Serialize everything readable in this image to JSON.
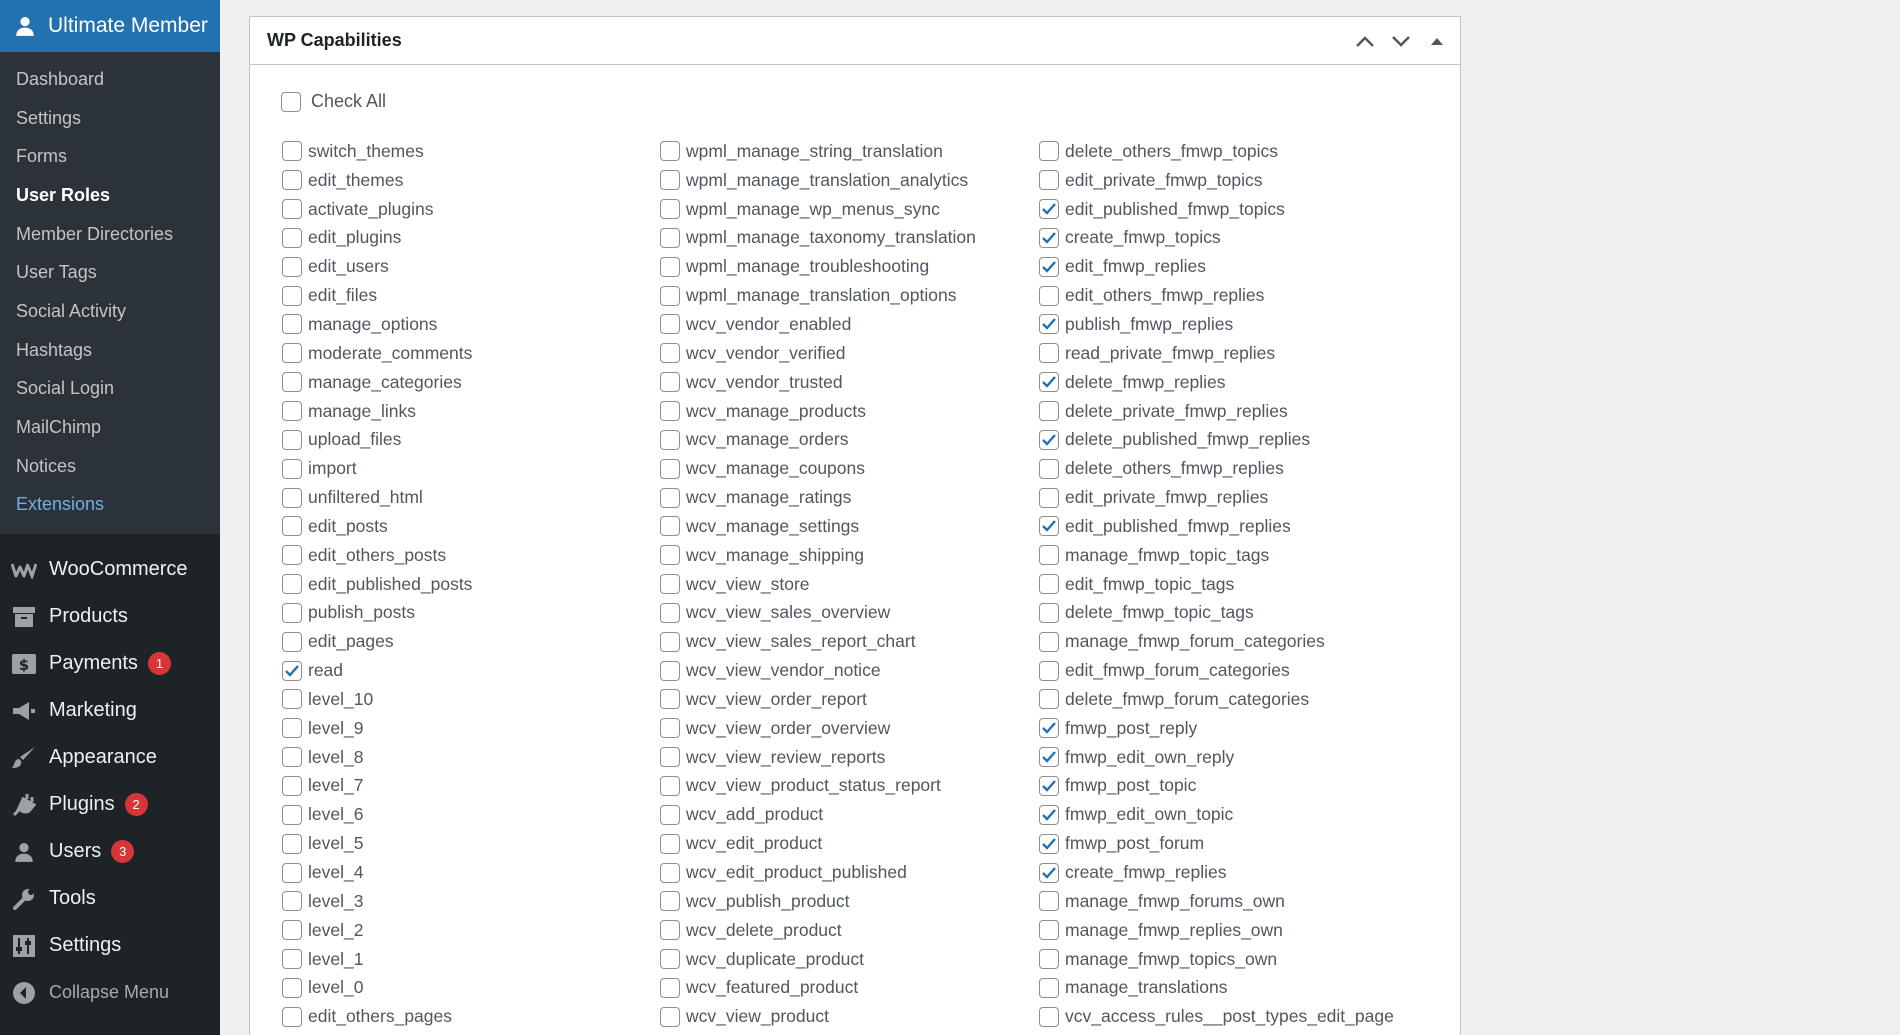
{
  "sidebar": {
    "header_label": "Ultimate Member",
    "header_icon": "user-icon",
    "submenu": [
      {
        "label": "Dashboard"
      },
      {
        "label": "Settings"
      },
      {
        "label": "Forms"
      },
      {
        "label": "User Roles",
        "current": true
      },
      {
        "label": "Member Directories"
      },
      {
        "label": "User Tags"
      },
      {
        "label": "Social Activity"
      },
      {
        "label": "Hashtags"
      },
      {
        "label": "Social Login"
      },
      {
        "label": "MailChimp"
      },
      {
        "label": "Notices"
      },
      {
        "label": "Extensions"
      }
    ],
    "menu": [
      {
        "label": "WooCommerce",
        "icon": "woocommerce-icon"
      },
      {
        "label": "Products",
        "icon": "archive-box-icon"
      },
      {
        "label": "Payments",
        "icon": "dollar-icon",
        "badge": "1"
      },
      {
        "label": "Marketing",
        "icon": "megaphone-icon"
      },
      {
        "label": "Appearance",
        "icon": "paintbrush-icon"
      },
      {
        "label": "Plugins",
        "icon": "plug-icon",
        "badge": "2"
      },
      {
        "label": "Users",
        "icon": "user-icon",
        "badge": "3"
      },
      {
        "label": "Tools",
        "icon": "wrench-icon"
      },
      {
        "label": "Settings",
        "icon": "settings-sliders-icon"
      }
    ],
    "collapse_label": "Collapse Menu"
  },
  "panel": {
    "title": "WP Capabilities",
    "check_all_label": "Check All",
    "columns": [
      [
        {
          "name": "switch_themes",
          "checked": false
        },
        {
          "name": "edit_themes",
          "checked": false
        },
        {
          "name": "activate_plugins",
          "checked": false
        },
        {
          "name": "edit_plugins",
          "checked": false
        },
        {
          "name": "edit_users",
          "checked": false
        },
        {
          "name": "edit_files",
          "checked": false
        },
        {
          "name": "manage_options",
          "checked": false
        },
        {
          "name": "moderate_comments",
          "checked": false
        },
        {
          "name": "manage_categories",
          "checked": false
        },
        {
          "name": "manage_links",
          "checked": false
        },
        {
          "name": "upload_files",
          "checked": false
        },
        {
          "name": "import",
          "checked": false
        },
        {
          "name": "unfiltered_html",
          "checked": false
        },
        {
          "name": "edit_posts",
          "checked": false
        },
        {
          "name": "edit_others_posts",
          "checked": false
        },
        {
          "name": "edit_published_posts",
          "checked": false
        },
        {
          "name": "publish_posts",
          "checked": false
        },
        {
          "name": "edit_pages",
          "checked": false
        },
        {
          "name": "read",
          "checked": true
        },
        {
          "name": "level_10",
          "checked": false
        },
        {
          "name": "level_9",
          "checked": false
        },
        {
          "name": "level_8",
          "checked": false
        },
        {
          "name": "level_7",
          "checked": false
        },
        {
          "name": "level_6",
          "checked": false
        },
        {
          "name": "level_5",
          "checked": false
        },
        {
          "name": "level_4",
          "checked": false
        },
        {
          "name": "level_3",
          "checked": false
        },
        {
          "name": "level_2",
          "checked": false
        },
        {
          "name": "level_1",
          "checked": false
        },
        {
          "name": "level_0",
          "checked": false
        },
        {
          "name": "edit_others_pages",
          "checked": false
        }
      ],
      [
        {
          "name": "wpml_manage_string_translation",
          "checked": false
        },
        {
          "name": "wpml_manage_translation_analytics",
          "checked": false
        },
        {
          "name": "wpml_manage_wp_menus_sync",
          "checked": false
        },
        {
          "name": "wpml_manage_taxonomy_translation",
          "checked": false
        },
        {
          "name": "wpml_manage_troubleshooting",
          "checked": false
        },
        {
          "name": "wpml_manage_translation_options",
          "checked": false
        },
        {
          "name": "wcv_vendor_enabled",
          "checked": false
        },
        {
          "name": "wcv_vendor_verified",
          "checked": false
        },
        {
          "name": "wcv_vendor_trusted",
          "checked": false
        },
        {
          "name": "wcv_manage_products",
          "checked": false
        },
        {
          "name": "wcv_manage_orders",
          "checked": false
        },
        {
          "name": "wcv_manage_coupons",
          "checked": false
        },
        {
          "name": "wcv_manage_ratings",
          "checked": false
        },
        {
          "name": "wcv_manage_settings",
          "checked": false
        },
        {
          "name": "wcv_manage_shipping",
          "checked": false
        },
        {
          "name": "wcv_view_store",
          "checked": false
        },
        {
          "name": "wcv_view_sales_overview",
          "checked": false
        },
        {
          "name": "wcv_view_sales_report_chart",
          "checked": false
        },
        {
          "name": "wcv_view_vendor_notice",
          "checked": false
        },
        {
          "name": "wcv_view_order_report",
          "checked": false
        },
        {
          "name": "wcv_view_order_overview",
          "checked": false
        },
        {
          "name": "wcv_view_review_reports",
          "checked": false
        },
        {
          "name": "wcv_view_product_status_report",
          "checked": false
        },
        {
          "name": "wcv_add_product",
          "checked": false
        },
        {
          "name": "wcv_edit_product",
          "checked": false
        },
        {
          "name": "wcv_edit_product_published",
          "checked": false
        },
        {
          "name": "wcv_publish_product",
          "checked": false
        },
        {
          "name": "wcv_delete_product",
          "checked": false
        },
        {
          "name": "wcv_duplicate_product",
          "checked": false
        },
        {
          "name": "wcv_featured_product",
          "checked": false
        },
        {
          "name": "wcv_view_product",
          "checked": false
        }
      ],
      [
        {
          "name": "delete_others_fmwp_topics",
          "checked": false
        },
        {
          "name": "edit_private_fmwp_topics",
          "checked": false
        },
        {
          "name": "edit_published_fmwp_topics",
          "checked": true
        },
        {
          "name": "create_fmwp_topics",
          "checked": true
        },
        {
          "name": "edit_fmwp_replies",
          "checked": true
        },
        {
          "name": "edit_others_fmwp_replies",
          "checked": false
        },
        {
          "name": "publish_fmwp_replies",
          "checked": true
        },
        {
          "name": "read_private_fmwp_replies",
          "checked": false
        },
        {
          "name": "delete_fmwp_replies",
          "checked": true
        },
        {
          "name": "delete_private_fmwp_replies",
          "checked": false
        },
        {
          "name": "delete_published_fmwp_replies",
          "checked": true
        },
        {
          "name": "delete_others_fmwp_replies",
          "checked": false
        },
        {
          "name": "edit_private_fmwp_replies",
          "checked": false
        },
        {
          "name": "edit_published_fmwp_replies",
          "checked": true
        },
        {
          "name": "manage_fmwp_topic_tags",
          "checked": false
        },
        {
          "name": "edit_fmwp_topic_tags",
          "checked": false
        },
        {
          "name": "delete_fmwp_topic_tags",
          "checked": false
        },
        {
          "name": "manage_fmwp_forum_categories",
          "checked": false
        },
        {
          "name": "edit_fmwp_forum_categories",
          "checked": false
        },
        {
          "name": "delete_fmwp_forum_categories",
          "checked": false
        },
        {
          "name": "fmwp_post_reply",
          "checked": true
        },
        {
          "name": "fmwp_edit_own_reply",
          "checked": true
        },
        {
          "name": "fmwp_post_topic",
          "checked": true
        },
        {
          "name": "fmwp_edit_own_topic",
          "checked": true
        },
        {
          "name": "fmwp_post_forum",
          "checked": true
        },
        {
          "name": "create_fmwp_replies",
          "checked": true
        },
        {
          "name": "manage_fmwp_forums_own",
          "checked": false
        },
        {
          "name": "manage_fmwp_replies_own",
          "checked": false
        },
        {
          "name": "manage_fmwp_topics_own",
          "checked": false
        },
        {
          "name": "manage_translations",
          "checked": false
        },
        {
          "name": "vcv_access_rules__post_types_edit_page",
          "checked": false
        }
      ]
    ]
  },
  "colors": {
    "sidebar_bg": "#1d2327",
    "submenu_bg": "#2c3338",
    "accent": "#2271b1",
    "link": "#72aee6",
    "badge": "#d63638",
    "check": "#2271b1"
  }
}
